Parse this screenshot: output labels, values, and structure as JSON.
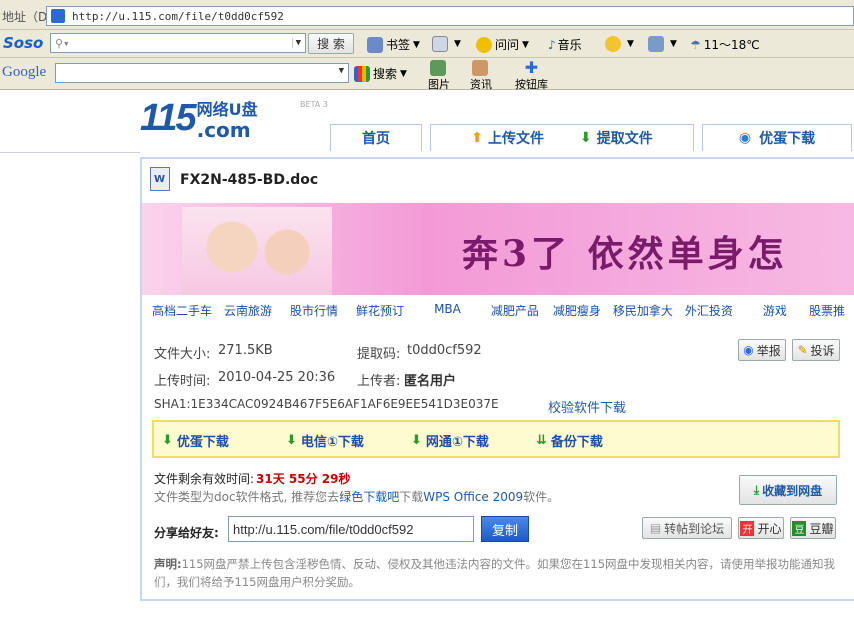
{
  "address_bar": {
    "label": "地址（D）",
    "url": "http://u.115.com/file/t0dd0cf592"
  },
  "soso_bar": {
    "logo": "Soso",
    "search_button": "搜 索",
    "bookmarks": "书签",
    "ask": "问问",
    "music": "音乐",
    "weather": "11～18℃"
  },
  "google_bar": {
    "logo": "Google",
    "search": "搜索",
    "images": "图片",
    "news": "资讯",
    "toolbox": "按钮库"
  },
  "site": {
    "logo_num": "115",
    "logo_text": "网络U盘",
    "logo_dom": ".com",
    "beta": "BETA 3",
    "nav": {
      "home": "首页",
      "upload": "上传文件",
      "fetch": "提取文件",
      "vip": "优蛋下载"
    }
  },
  "file": {
    "name": "FX2N-485-BD.doc",
    "size_label": "文件大小:",
    "size": "271.5KB",
    "code_label": "提取码:",
    "code": "t0dd0cf592",
    "time_label": "上传时间:",
    "time": "2010-04-25 20:36",
    "uploader_label": "上传者:",
    "uploader": "匿名用户",
    "sha1": "SHA1:1E334CAC0924B467F5E6AF1AF6E9EE541D3E037E",
    "verify_link": "校验软件下载",
    "report": "举报",
    "complain": "投诉"
  },
  "banner": {
    "text": "奔3了  依然单身怎"
  },
  "keywords": [
    "高档二手车",
    "云南旅游",
    "股市行情",
    "鲜花预订",
    "MBA",
    "减肥产品",
    "减肥瘦身",
    "移民加拿大",
    "外汇投资",
    "游戏",
    "股票推"
  ],
  "downloads": [
    "优蛋下载",
    "电信①下载",
    "网通①下载",
    "备份下载"
  ],
  "remaining": {
    "label": "文件剩余有效时间:",
    "value": "31天 55分 29秒"
  },
  "filetype": {
    "pre": "文件类型为doc软件格式, 推荐您去",
    "link1": "绿色下载吧",
    "mid": "下载",
    "link2": "WPS Office 2009",
    "post": "软件。"
  },
  "collect": "收藏到网盘",
  "share": {
    "label": "分享给好友:",
    "url": "http://u.115.com/file/t0dd0cf592",
    "copy": "复制",
    "forum": "转帖到论坛",
    "kaixin": "开心",
    "douban": "豆瓣"
  },
  "disclaimer": {
    "bold": "声明:",
    "text": "115网盘严禁上传包含淫秽色情、反动、侵权及其他违法内容的文件。如果您在115网盘中发现相关内容，请使用举报功能通知我们，我们将给予115网盘用户积分奖励。"
  },
  "colors": {
    "accent": "#1e5aa8",
    "remaining": "#cc0000",
    "banner": "#f3a6d8"
  }
}
